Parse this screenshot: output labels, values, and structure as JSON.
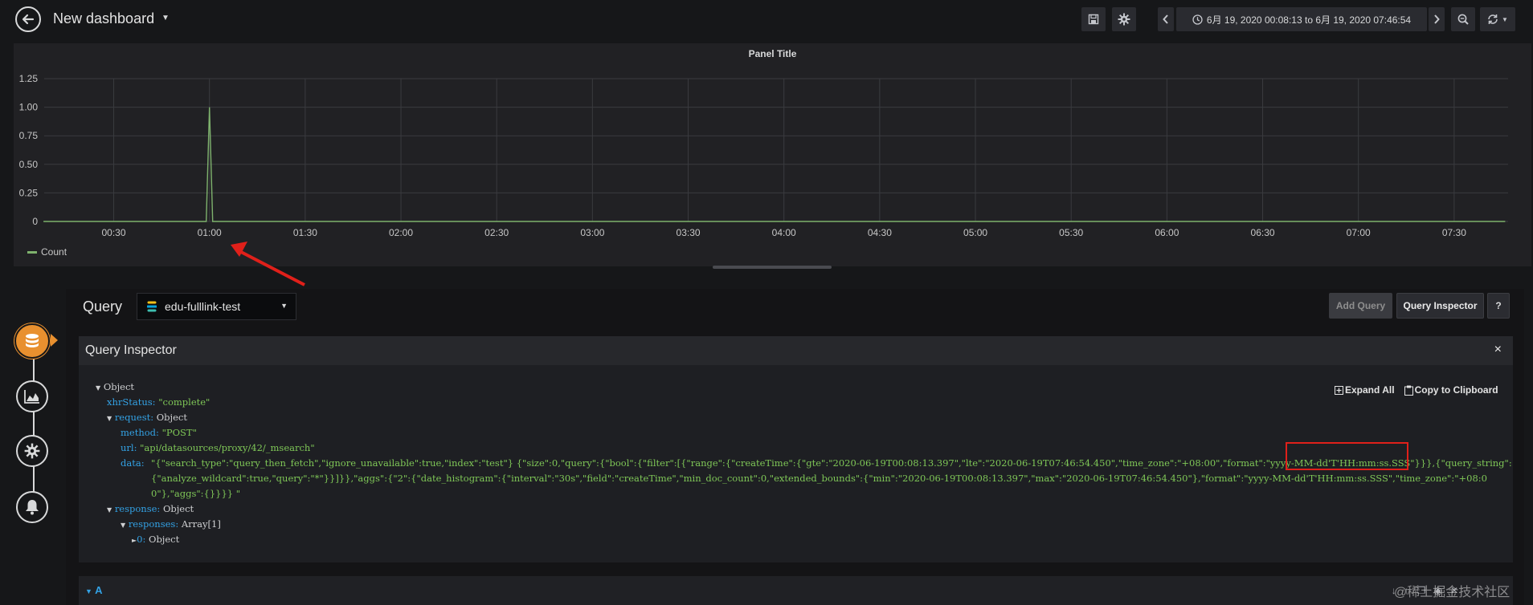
{
  "header": {
    "title": "New dashboard",
    "time_range": "6月 19, 2020 00:08:13 to 6月 19, 2020 07:46:54"
  },
  "panel": {
    "title": "Panel Title",
    "legend": "Count"
  },
  "chart_data": {
    "type": "line",
    "series": [
      {
        "name": "Count",
        "color": "#7eb26d",
        "points": [
          [
            "00:08",
            0
          ],
          [
            "00:59",
            0
          ],
          [
            "01:00",
            1
          ],
          [
            "01:01",
            0
          ],
          [
            "07:46",
            0
          ]
        ]
      }
    ],
    "x_ticks": [
      "00:30",
      "01:00",
      "01:30",
      "02:00",
      "02:30",
      "03:00",
      "03:30",
      "04:00",
      "04:30",
      "05:00",
      "05:30",
      "06:00",
      "06:30",
      "07:00",
      "07:30"
    ],
    "y_ticks": [
      "0",
      "0.25",
      "0.50",
      "0.75",
      "1.00",
      "1.25"
    ],
    "ylim": [
      0,
      1.25
    ],
    "grid": true,
    "legend_position": "bottom-left"
  },
  "query": {
    "label": "Query",
    "datasource": "edu-fulllink-test",
    "add_query": "Add Query",
    "query_inspector": "Query Inspector",
    "help": "?"
  },
  "inspector": {
    "title": "Query Inspector",
    "close": "×",
    "expand_all": "Expand All",
    "copy_clipboard": "Copy to Clipboard",
    "tree": {
      "root": "Object",
      "xhr_key": "xhrStatus:",
      "xhr_val": "\"complete\"",
      "request_key": "request:",
      "request_val": "Object",
      "method_key": "method:",
      "method_val": "\"POST\"",
      "url_key": "url:",
      "url_val": "\"api/datasources/proxy/42/_msearch\"",
      "data_key": "data:",
      "data_val": "\"{\"search_type\":\"query_then_fetch\",\"ignore_unavailable\":true,\"index\":\"test\"} {\"size\":0,\"query\":{\"bool\":{\"filter\":[{\"range\":{\"createTime\":{\"gte\":\"2020-06-19T00:08:13.397\",\"lte\":\"2020-06-19T07:46:54.450\",\"time_zone\":\"+08:00\",\"format\":\"yyyy-MM-dd'T'HH:mm:ss.SSS\"}}},{\"query_string\":{\"analyze_wildcard\":true,\"query\":\"*\"}}]}},\"aggs\":{\"2\":{\"date_histogram\":{\"interval\":\"30s\",\"field\":\"createTime\",\"min_doc_count\":0,\"extended_bounds\":{\"min\":\"2020-06-19T00:08:13.397\",\"max\":\"2020-06-19T07:46:54.450\"},\"format\":\"yyyy-MM-dd'T'HH:mm:ss.SSS\",\"time_zone\":\"+08:00\"},\"aggs\":{}}}} \"",
      "response_key": "response:",
      "response_val": "Object",
      "responses_key": "responses:",
      "responses_val": "Array[1]",
      "item_key": "0:",
      "item_val": "Object"
    }
  },
  "query_row": {
    "label": "A"
  },
  "watermark": "@稀土掘金技术社区"
}
